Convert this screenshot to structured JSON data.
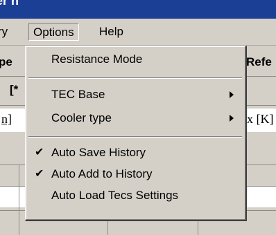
{
  "window": {
    "title_fragment": "er n"
  },
  "menubar": {
    "history": "ry",
    "options": "Options",
    "help": "Help"
  },
  "background": {
    "left_header": "pe",
    "right_header": "Refe",
    "left_bracket": "[*",
    "left_unit": "n]",
    "right_unit": "x [K]"
  },
  "options_menu": {
    "items": [
      {
        "label": "Resistance Mode",
        "checked": false,
        "submenu": false
      },
      {
        "label": "TEC Base",
        "checked": false,
        "submenu": true
      },
      {
        "label": "Cooler type",
        "checked": false,
        "submenu": true
      },
      {
        "label": "Auto Save History",
        "checked": true,
        "submenu": false
      },
      {
        "label": "Auto Add to History",
        "checked": true,
        "submenu": false
      },
      {
        "label": "Auto Load Tecs Settings",
        "checked": false,
        "submenu": false
      }
    ],
    "check_glyph": "✔"
  },
  "colors": {
    "face": "#d4d0c8",
    "titlebar": "#1c3f96"
  }
}
